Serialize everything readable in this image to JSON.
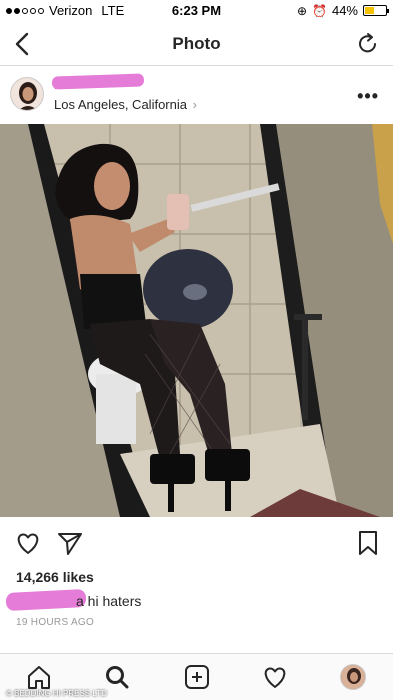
{
  "status_bar": {
    "carrier": "Verizon",
    "network": "LTE",
    "time": "6:23 PM",
    "battery": "44%",
    "battery_level": 0.44
  },
  "nav": {
    "title": "Photo",
    "back_icon": "chevron-left-icon",
    "refresh_icon": "refresh-icon"
  },
  "post": {
    "location": "Los Angeles, California",
    "location_chevron": "›",
    "more_label": "•••",
    "likes": "14,266 likes",
    "caption_text": "a hi haters",
    "timestamp": "19 HOURS AGO"
  },
  "tabbar": {
    "items": [
      "home-icon",
      "search-icon",
      "add-icon",
      "heart-icon",
      "profile-avatar"
    ]
  },
  "watermark": "© BEDDING HI PRESS LTD",
  "colors": {
    "redaction": "#e57cd8",
    "battery": "#f5c400",
    "divider": "#dbdbdb"
  }
}
